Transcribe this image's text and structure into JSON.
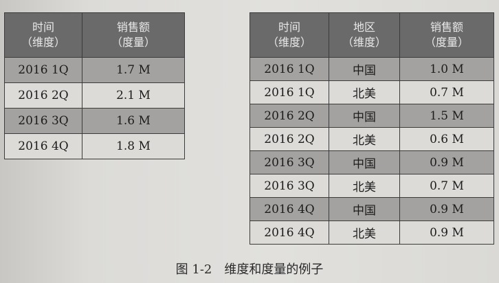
{
  "left_table": {
    "headers": [
      {
        "line1": "时间",
        "line2": "（维度）"
      },
      {
        "line1": "销售额",
        "line2": "（度量）"
      }
    ],
    "rows": [
      [
        "2016 1Q",
        "1.7 M"
      ],
      [
        "2016 2Q",
        "2.1 M"
      ],
      [
        "2016 3Q",
        "1.6 M"
      ],
      [
        "2016 4Q",
        "1.8 M"
      ]
    ]
  },
  "right_table": {
    "headers": [
      {
        "line1": "时间",
        "line2": "（维度）"
      },
      {
        "line1": "地区",
        "line2": "（维度）"
      },
      {
        "line1": "销售额",
        "line2": "（度量）"
      }
    ],
    "rows": [
      [
        "2016 1Q",
        "中国",
        "1.0 M"
      ],
      [
        "2016 1Q",
        "北美",
        "0.7 M"
      ],
      [
        "2016 2Q",
        "中国",
        "1.5 M"
      ],
      [
        "2016 2Q",
        "北美",
        "0.6 M"
      ],
      [
        "2016 3Q",
        "中国",
        "0.9 M"
      ],
      [
        "2016 3Q",
        "北美",
        "0.7 M"
      ],
      [
        "2016 4Q",
        "中国",
        "0.9 M"
      ],
      [
        "2016 4Q",
        "北美",
        "0.9 M"
      ]
    ]
  },
  "caption": {
    "number": "图 1-2",
    "text": "维度和度量的例子"
  },
  "colors": {
    "header_bg": "#6a6a6a",
    "shaded_row": "#a3a2a0",
    "light_row": "#dcdbd8",
    "page_bg": "#dad9d6"
  }
}
